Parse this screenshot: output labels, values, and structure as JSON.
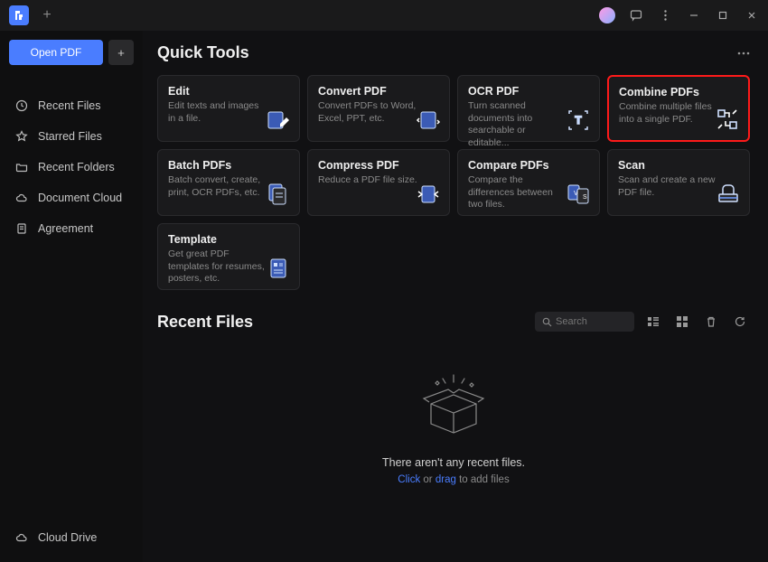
{
  "titlebar": {
    "new_tab_symbol": "+"
  },
  "sidebar": {
    "open_button": "Open PDF",
    "plus_symbol": "+",
    "items": [
      {
        "label": "Recent Files"
      },
      {
        "label": "Starred Files"
      },
      {
        "label": "Recent Folders"
      },
      {
        "label": "Document Cloud"
      },
      {
        "label": "Agreement"
      }
    ],
    "footer": {
      "label": "Cloud Drive"
    }
  },
  "quick_tools": {
    "title": "Quick Tools",
    "cards": [
      {
        "title": "Edit",
        "desc": "Edit texts and images in a file."
      },
      {
        "title": "Convert PDF",
        "desc": "Convert PDFs to Word, Excel, PPT, etc."
      },
      {
        "title": "OCR PDF",
        "desc": "Turn scanned documents into searchable or editable..."
      },
      {
        "title": "Combine PDFs",
        "desc": "Combine multiple files into a single PDF.",
        "highlighted": true
      },
      {
        "title": "Batch PDFs",
        "desc": "Batch convert, create, print, OCR PDFs, etc."
      },
      {
        "title": "Compress PDF",
        "desc": "Reduce a PDF file size."
      },
      {
        "title": "Compare PDFs",
        "desc": "Compare the differences between two files."
      },
      {
        "title": "Scan",
        "desc": "Scan and create a new PDF file."
      },
      {
        "title": "Template",
        "desc": "Get great PDF templates for resumes, posters, etc."
      }
    ]
  },
  "recent_files": {
    "title": "Recent Files",
    "search_placeholder": "Search",
    "empty_message": "There aren't any recent files.",
    "empty_action_prefix": "Click",
    "empty_action_or": " or ",
    "empty_action_drag": "drag",
    "empty_action_suffix": " to add files"
  }
}
